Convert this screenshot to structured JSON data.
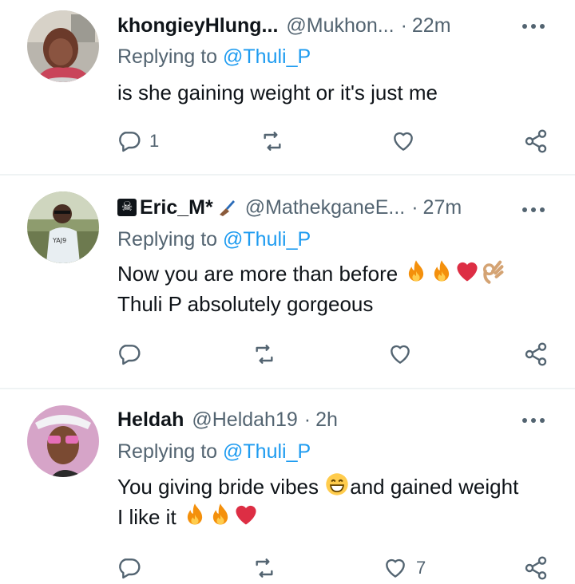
{
  "reply_prefix": "Replying to",
  "tweets": [
    {
      "display_name": "khongieyHlung...",
      "handle": "@Mukhon...",
      "time": "22m",
      "reply_to": "@Thuli_P",
      "lines": [
        "is she gaining weight or it's just me"
      ],
      "counts": {
        "reply": "1",
        "retweet": "",
        "like": "",
        "share": ""
      }
    },
    {
      "display_name": "Eric_M*",
      "handle": "@MathekganeE...",
      "time": "27m",
      "reply_to": "@Thuli_P",
      "lines": [
        "Now you are more than before",
        "Thuli P absolutely gorgeous"
      ],
      "counts": {
        "reply": "",
        "retweet": "",
        "like": "",
        "share": ""
      }
    },
    {
      "display_name": "Heldah",
      "handle": "@Heldah19",
      "time": "2h",
      "reply_to": "@Thuli_P",
      "lines": [
        "You giving bride vibes",
        "and gained weight",
        "I like it"
      ],
      "counts": {
        "reply": "",
        "retweet": "",
        "like": "7",
        "share": ""
      }
    }
  ],
  "colors": {
    "text": "#0f1419",
    "muted": "#536471",
    "link": "#1d9bf0",
    "divider": "#eff3f4"
  },
  "icons": [
    "more-icon",
    "reply-icon",
    "retweet-icon",
    "like-icon",
    "share-icon",
    "skull-icon",
    "writing-hand-icon",
    "fire-icon",
    "red-heart-icon",
    "ok-hand-icon",
    "grinning-face-icon"
  ]
}
